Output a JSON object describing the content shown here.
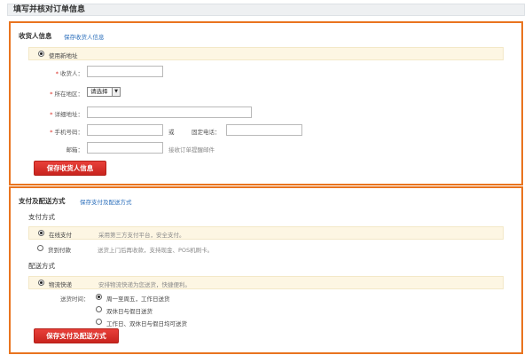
{
  "page": {
    "title": "填写并核对订单信息"
  },
  "consignee": {
    "title": "收货人信息",
    "save_link": "保存收货人信息",
    "use_new_address": "使用新地址",
    "fields": {
      "name_label": "收货人：",
      "region_label": "所在地区：",
      "region_value": "请选择",
      "address_label": "详细地址：",
      "mobile_label": "手机号码：",
      "or_text": "或",
      "phone_label": "固定电话：",
      "email_label": "邮箱：",
      "email_hint": "接收订单提醒邮件"
    },
    "save_button": "保存收货人信息"
  },
  "payment": {
    "title": "支付及配送方式",
    "save_link": "保存支付及配送方式",
    "pay_section": "支付方式",
    "pay_options": [
      {
        "label": "在线支付",
        "desc": "采用第三方支付平台，安全支付。",
        "checked": true
      },
      {
        "label": "货到付款",
        "desc": "送货上门后再收款，支持现金、POS机刷卡。",
        "checked": false
      }
    ],
    "delivery_section": "配送方式",
    "delivery_option": {
      "label": "物流快递",
      "desc": "安排物流快递为您送货，快捷便利。",
      "checked": true
    },
    "delivery_time_label": "送货时间：",
    "delivery_times": [
      {
        "label": "周一至周五，工作日送货",
        "checked": true
      },
      {
        "label": "双休日与假日送货",
        "checked": false
      },
      {
        "label": "工作日、双休日与假日均可送货",
        "checked": false
      }
    ],
    "save_button": "保存支付及配送方式"
  }
}
